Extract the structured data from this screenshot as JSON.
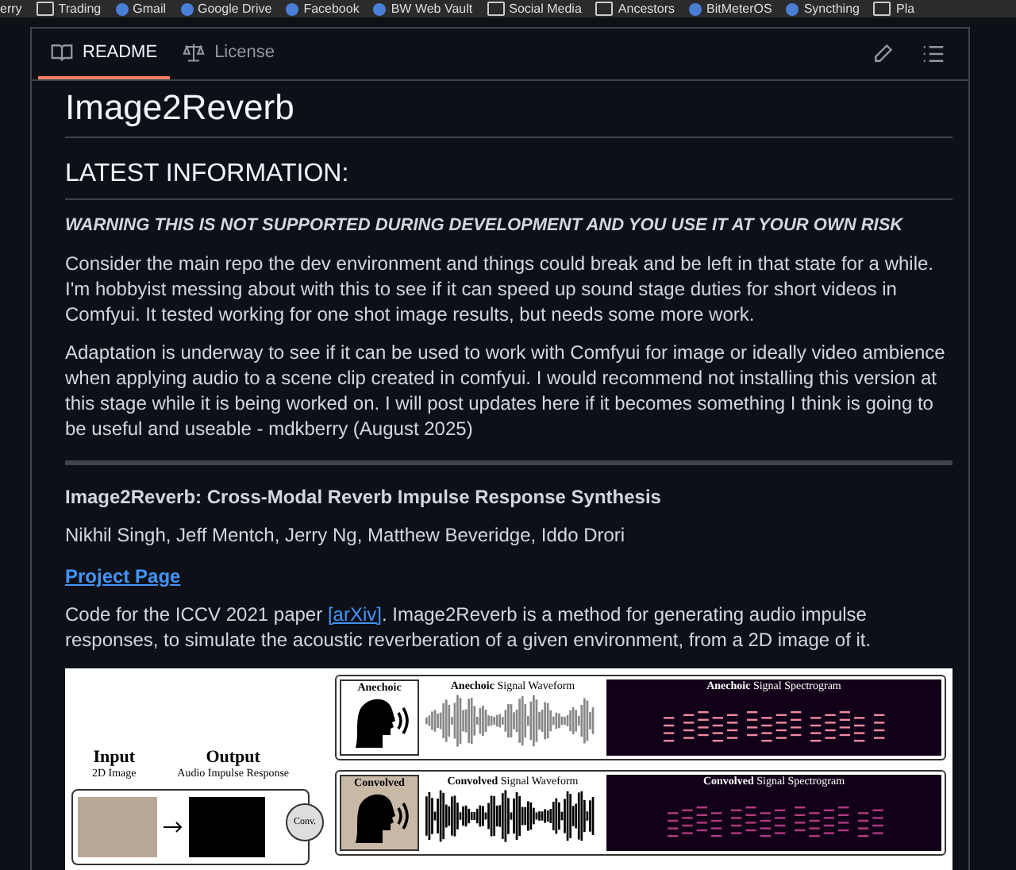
{
  "bookmarks": [
    {
      "label": "erry",
      "kind": "text"
    },
    {
      "label": "Trading",
      "kind": "folder"
    },
    {
      "label": "Gmail",
      "kind": "site"
    },
    {
      "label": "Google Drive",
      "kind": "site"
    },
    {
      "label": "Facebook",
      "kind": "site"
    },
    {
      "label": "BW Web Vault",
      "kind": "site"
    },
    {
      "label": "Social Media",
      "kind": "folder"
    },
    {
      "label": "Ancestors",
      "kind": "folder"
    },
    {
      "label": "BitMeterOS",
      "kind": "site"
    },
    {
      "label": "Syncthing",
      "kind": "site"
    },
    {
      "label": "Pla",
      "kind": "folder"
    }
  ],
  "tabs": [
    {
      "label": "README",
      "kind": "book",
      "selected": true
    },
    {
      "label": "License",
      "kind": "scale",
      "selected": false
    }
  ],
  "readme": {
    "title": "Image2Reverb",
    "section_heading": "LATEST INFORMATION:",
    "warning": "WARNING THIS IS NOT SUPPORTED DURING DEVELOPMENT AND YOU USE IT AT YOUR OWN RISK",
    "paragraphs": [
      "Consider the main repo the dev environment and things could break and be left in that state for a while. I'm hobbyist messing about with this to see if it can speed up sound stage duties for short videos in Comfyui. It tested working for one shot image results, but needs some more work.",
      "Adaptation is underway to see if it can be used to work with Comfyui for image or ideally video ambience when applying audio to a scene clip created in comfyui. I would recommend not installing this version at this stage while it is being worked on. I will post updates here if it becomes something I think is going to be useful and useable - mdkberry (August 2025)"
    ],
    "paper_title": "Image2Reverb: Cross-Modal Reverb Impulse Response Synthesis",
    "authors": "Nikhil Singh, Jeff Mentch, Jerry Ng, Matthew Beveridge, Iddo Drori",
    "project_link": "Project Page",
    "description_before": "Code for the ICCV 2021 paper ",
    "description_link": "[arXiv]",
    "description_after": ". Image2Reverb is a method for generating audio impulse responses, to simulate the acoustic reverberation of a given environment, from a 2D image of it.",
    "figure": {
      "input_title": "Input",
      "input_sub": "2D Image",
      "output_title": "Output",
      "output_sub": "Audio Impulse Response",
      "conv": "Conv.",
      "rows": [
        {
          "label": "Anechoic",
          "waveform_title": "**Anechoic** Signal Waveform",
          "spectrogram_title": "**Anechoic** Signal Spectrogram",
          "kind": "anechoic"
        },
        {
          "label": "Convolved",
          "waveform_title": "**Convolved** Signal Waveform",
          "spectrogram_title": "**Convolved** Signal Spectrogram",
          "kind": "convolved"
        }
      ]
    }
  }
}
